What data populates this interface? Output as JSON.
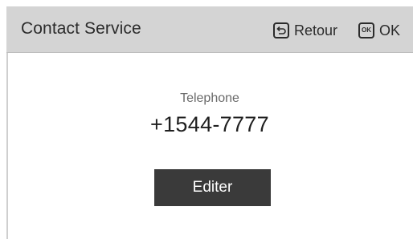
{
  "header": {
    "title": "Contact Service",
    "back_label": "Retour",
    "ok_icon_text": "OK",
    "ok_label": "OK"
  },
  "main": {
    "field_label": "Telephone",
    "phone_number": "+1544-7777",
    "edit_button_label": "Editer"
  },
  "colors": {
    "header_bg": "#d4d4d4",
    "button_bg": "#3a3a3a",
    "button_text": "#ffffff",
    "text": "#2b2b2b",
    "label_text": "#6a6a6a"
  }
}
